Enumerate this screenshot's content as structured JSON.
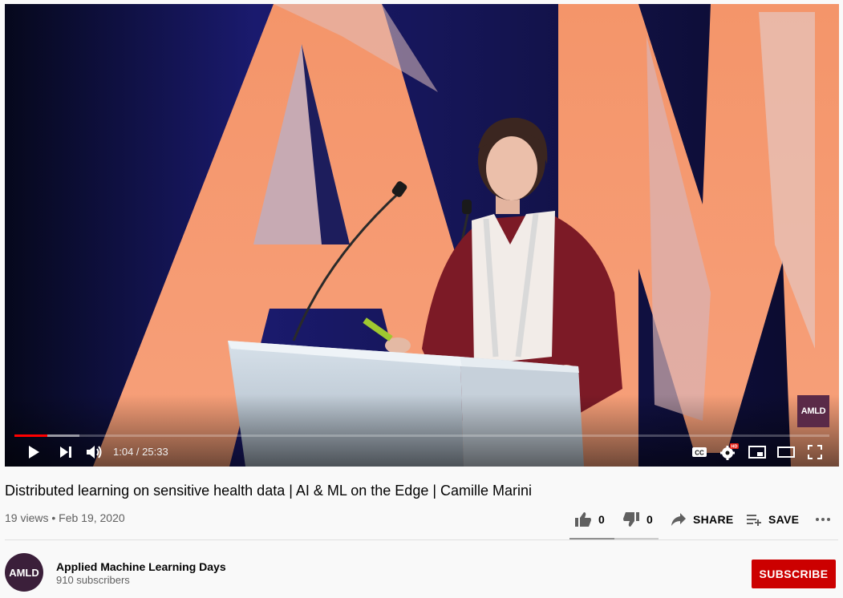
{
  "player": {
    "time_display": "1:04 / 25:33",
    "watermark": "AMLD",
    "progress": {
      "played_fraction": 0.04,
      "buffered_fraction": 0.08
    },
    "accent_color": "#ff0000",
    "icons": [
      "play-icon",
      "next-icon",
      "volume-icon",
      "captions-icon",
      "settings-hd-icon",
      "miniplayer-icon",
      "theater-icon",
      "fullscreen-icon"
    ],
    "settings_badge": "HD"
  },
  "video": {
    "title": "Distributed learning on sensitive health data | AI & ML on the Edge | Camille Marini",
    "views": "19 views",
    "separator": "•",
    "date": "Feb 19, 2020"
  },
  "actions": {
    "like_count": "0",
    "dislike_count": "0",
    "share_label": "SHARE",
    "save_label": "SAVE"
  },
  "channel": {
    "avatar_text": "AMLD",
    "name": "Applied Machine Learning Days",
    "subscribers": "910 subscribers",
    "subscribe_label": "SUBSCRIBE",
    "subscribe_color": "#cc0000"
  }
}
